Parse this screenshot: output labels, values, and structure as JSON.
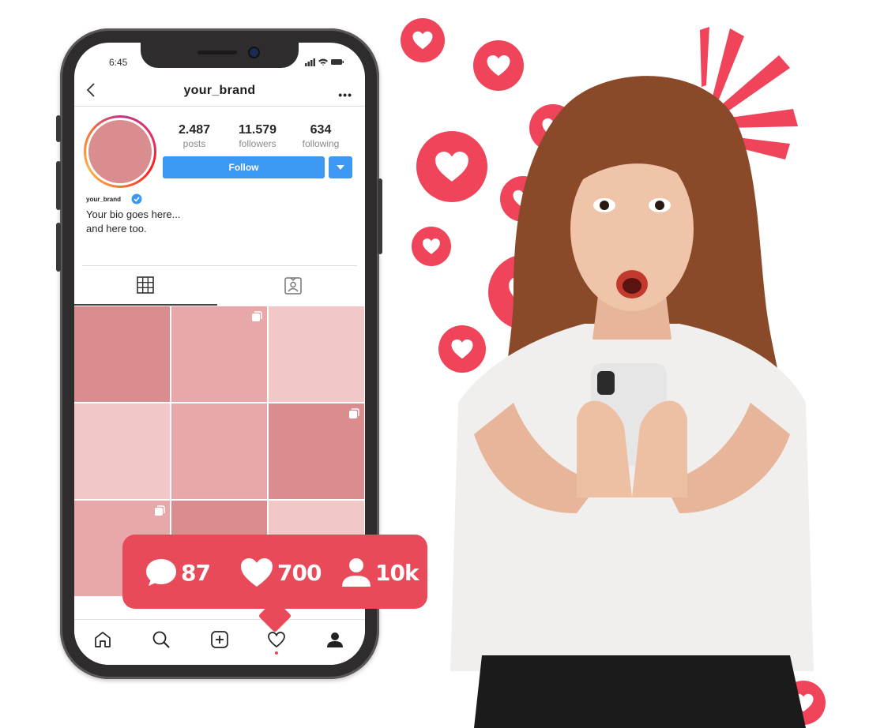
{
  "status_bar": {
    "time": "6:45"
  },
  "profile": {
    "header_username": "your_brand",
    "more_label": "•••",
    "stats": [
      {
        "value": "2.487",
        "label": "posts"
      },
      {
        "value": "11.579",
        "label": "followers"
      },
      {
        "value": "634",
        "label": "following"
      }
    ],
    "follow_label": "Follow",
    "name": "your_brand",
    "bio_line1": "Your bio goes here...",
    "bio_line2": "and here too."
  },
  "notification": {
    "comments": "87",
    "likes": "700",
    "followers": "10k"
  },
  "colors": {
    "accent": "#e84a5a",
    "follow_blue": "#3d98f4",
    "tile_dark": "#d98d8f",
    "tile_mid": "#e8a8a9",
    "tile_light": "#f2c7c8"
  },
  "icons": [
    "back-icon",
    "more-icon",
    "verified-icon",
    "grid-icon",
    "tagged-icon",
    "multi-post-icon",
    "home-icon",
    "search-icon",
    "add-post-icon",
    "activity-heart-icon",
    "profile-icon",
    "comment-icon",
    "heart-icon",
    "user-icon"
  ]
}
